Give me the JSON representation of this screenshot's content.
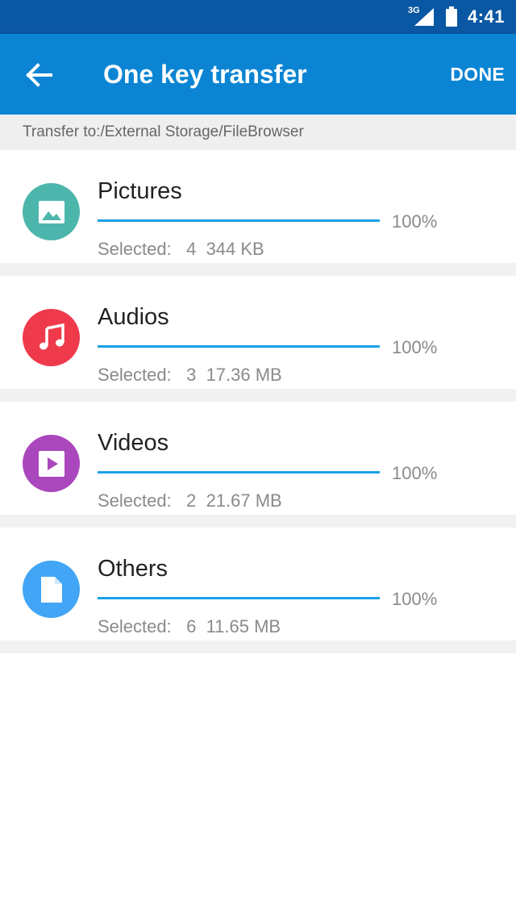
{
  "status_bar": {
    "network": "3G",
    "time": "4:41"
  },
  "app_bar": {
    "title": "One key transfer",
    "done_label": "DONE"
  },
  "path": {
    "text": "Transfer to:/External Storage/FileBrowser"
  },
  "colors": {
    "status_bar": "#0a57a3",
    "app_bar": "#0b85d3",
    "progress": "#1aa0e6",
    "pictures": "#4db6ac",
    "audios": "#ef3a4c",
    "videos": "#ab47bc",
    "others": "#42a5f5"
  },
  "categories": [
    {
      "name": "Pictures",
      "progress": 1.0,
      "percent": "100%",
      "selected_label": "Selected:",
      "count": "4",
      "size": "344 KB",
      "icon": "image-icon"
    },
    {
      "name": "Audios",
      "progress": 1.0,
      "percent": "100%",
      "selected_label": "Selected:",
      "count": "3",
      "size": "17.36 MB",
      "icon": "music-note-icon"
    },
    {
      "name": "Videos",
      "progress": 1.0,
      "percent": "100%",
      "selected_label": "Selected:",
      "count": "2",
      "size": "21.67 MB",
      "icon": "video-play-icon"
    },
    {
      "name": "Others",
      "progress": 1.0,
      "percent": "100%",
      "selected_label": "Selected:",
      "count": "6",
      "size": "11.65 MB",
      "icon": "document-icon"
    }
  ]
}
